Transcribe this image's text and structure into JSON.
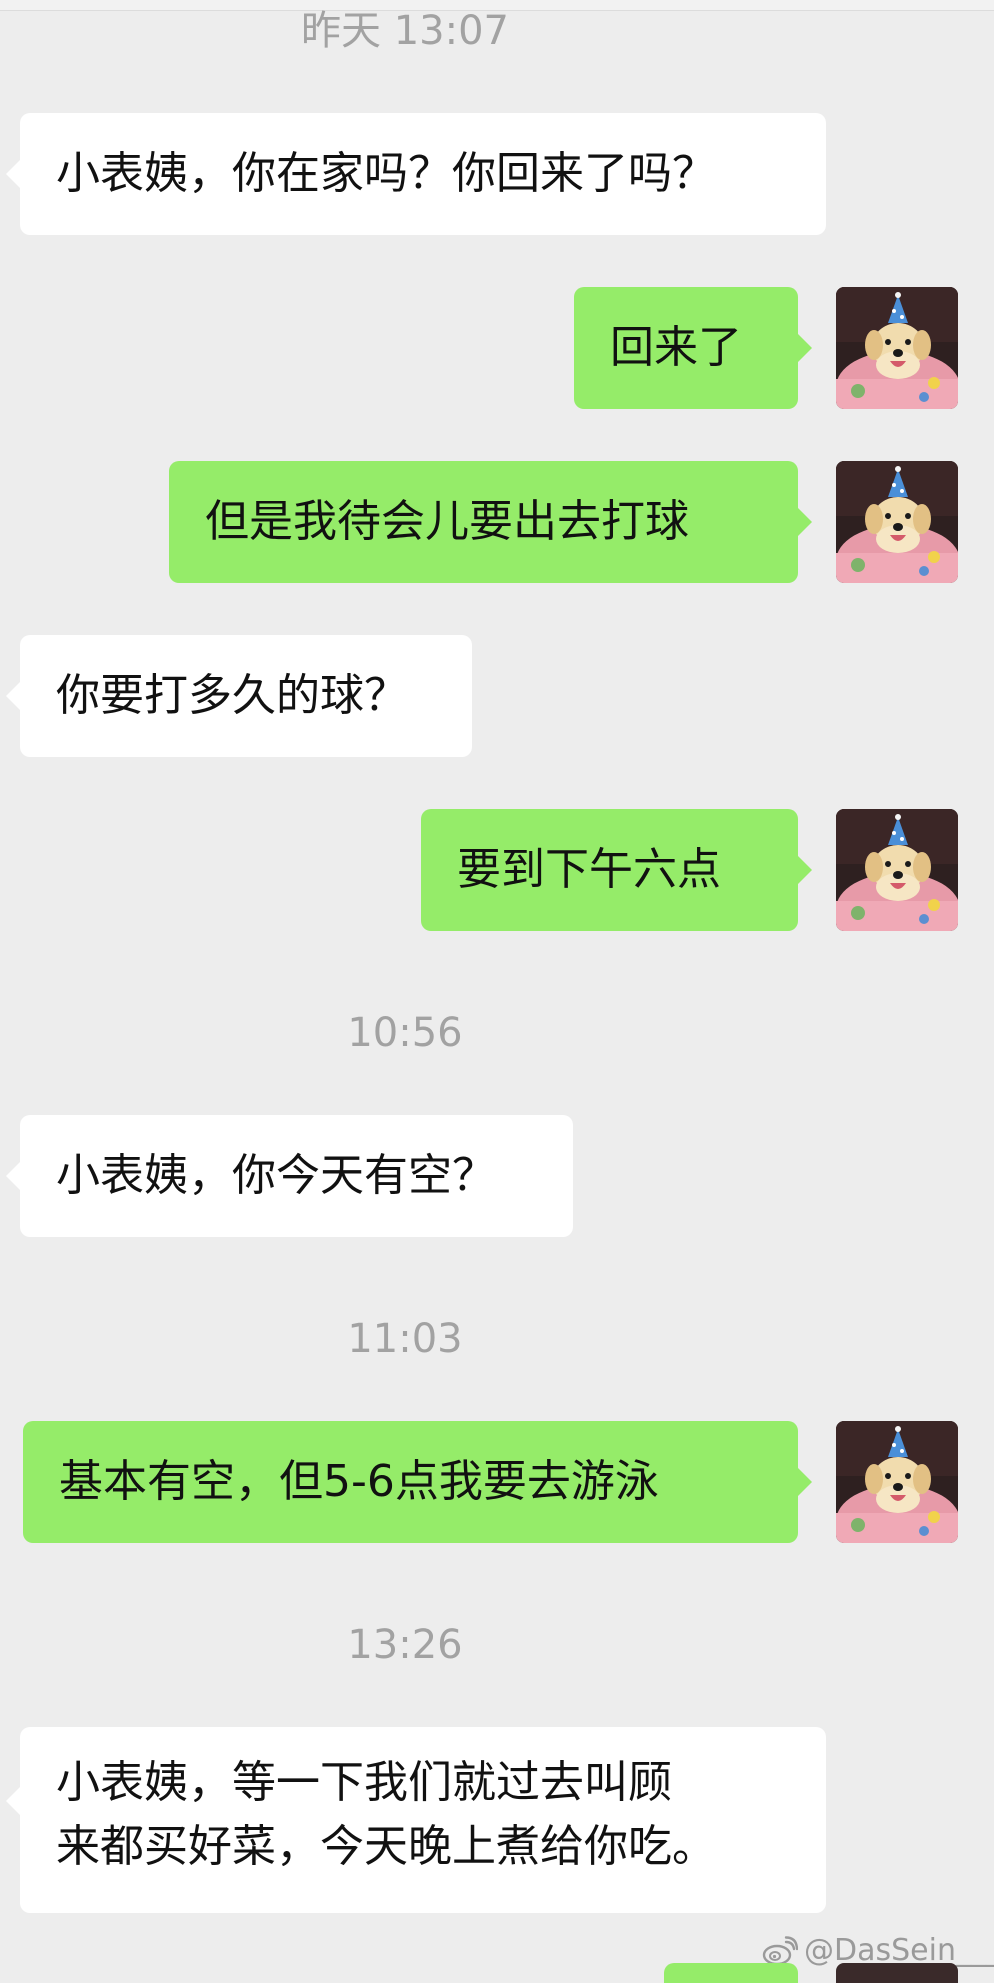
{
  "chat": {
    "timestamps": [
      "昨天 13:07",
      "10:56",
      "11:03",
      "13:26"
    ],
    "messages": [
      {
        "from": "them",
        "text": "小表姨，你在家吗？你回来了吗？"
      },
      {
        "from": "me",
        "text": "回来了"
      },
      {
        "from": "me",
        "text": "但是我待会儿要出去打球"
      },
      {
        "from": "them",
        "text": "你要打多久的球？"
      },
      {
        "from": "me",
        "text": "要到下午六点"
      },
      {
        "from": "them",
        "text": "小表姨，你今天有空？"
      },
      {
        "from": "me",
        "text": "基本有空，但5-6点我要去游泳"
      },
      {
        "from": "them",
        "lines": [
          "小表姨，等一下我们就过去叫顾",
          "来都买好菜，今天晚上煮给你吃。"
        ]
      }
    ]
  },
  "avatar_icon": "dog-party-hat-avatar",
  "watermark": {
    "icon": "weibo-logo-icon",
    "text": "@DasSein____"
  },
  "colors": {
    "background": "#ededed",
    "sent_bubble": "#95ec69",
    "received_bubble": "#ffffff",
    "timestamp": "#a2a2a2"
  }
}
